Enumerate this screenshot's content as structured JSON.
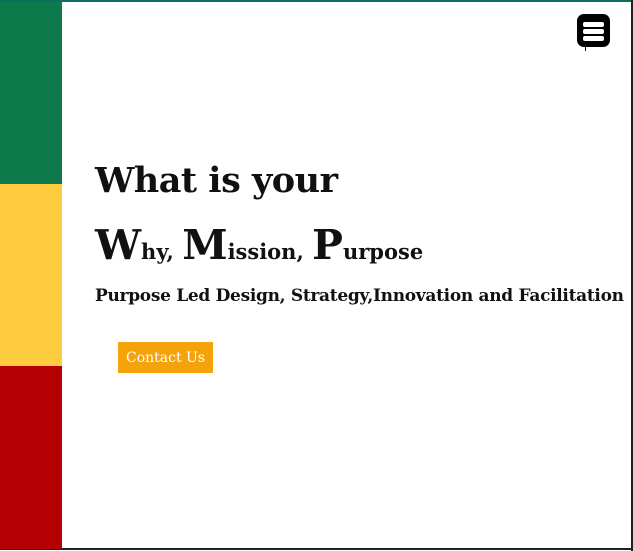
{
  "hero": {
    "headline": "What is your",
    "wmp": {
      "why_initial": "W",
      "why_rest": "hy,",
      "mission_initial": "M",
      "mission_rest": "ission,",
      "purpose_initial": "P",
      "purpose_rest": "urpose"
    },
    "tagline": "Purpose Led Design, Strategy,Innovation and Facilitation",
    "contact_label": "Contact Us"
  },
  "colors": {
    "stripe_green": "#0e7a4c",
    "stripe_yellow": "#fecc3e",
    "stripe_red": "#b40002",
    "button_accent": "#f5a30a"
  },
  "icons": {
    "menu": "hamburger-menu-icon"
  }
}
